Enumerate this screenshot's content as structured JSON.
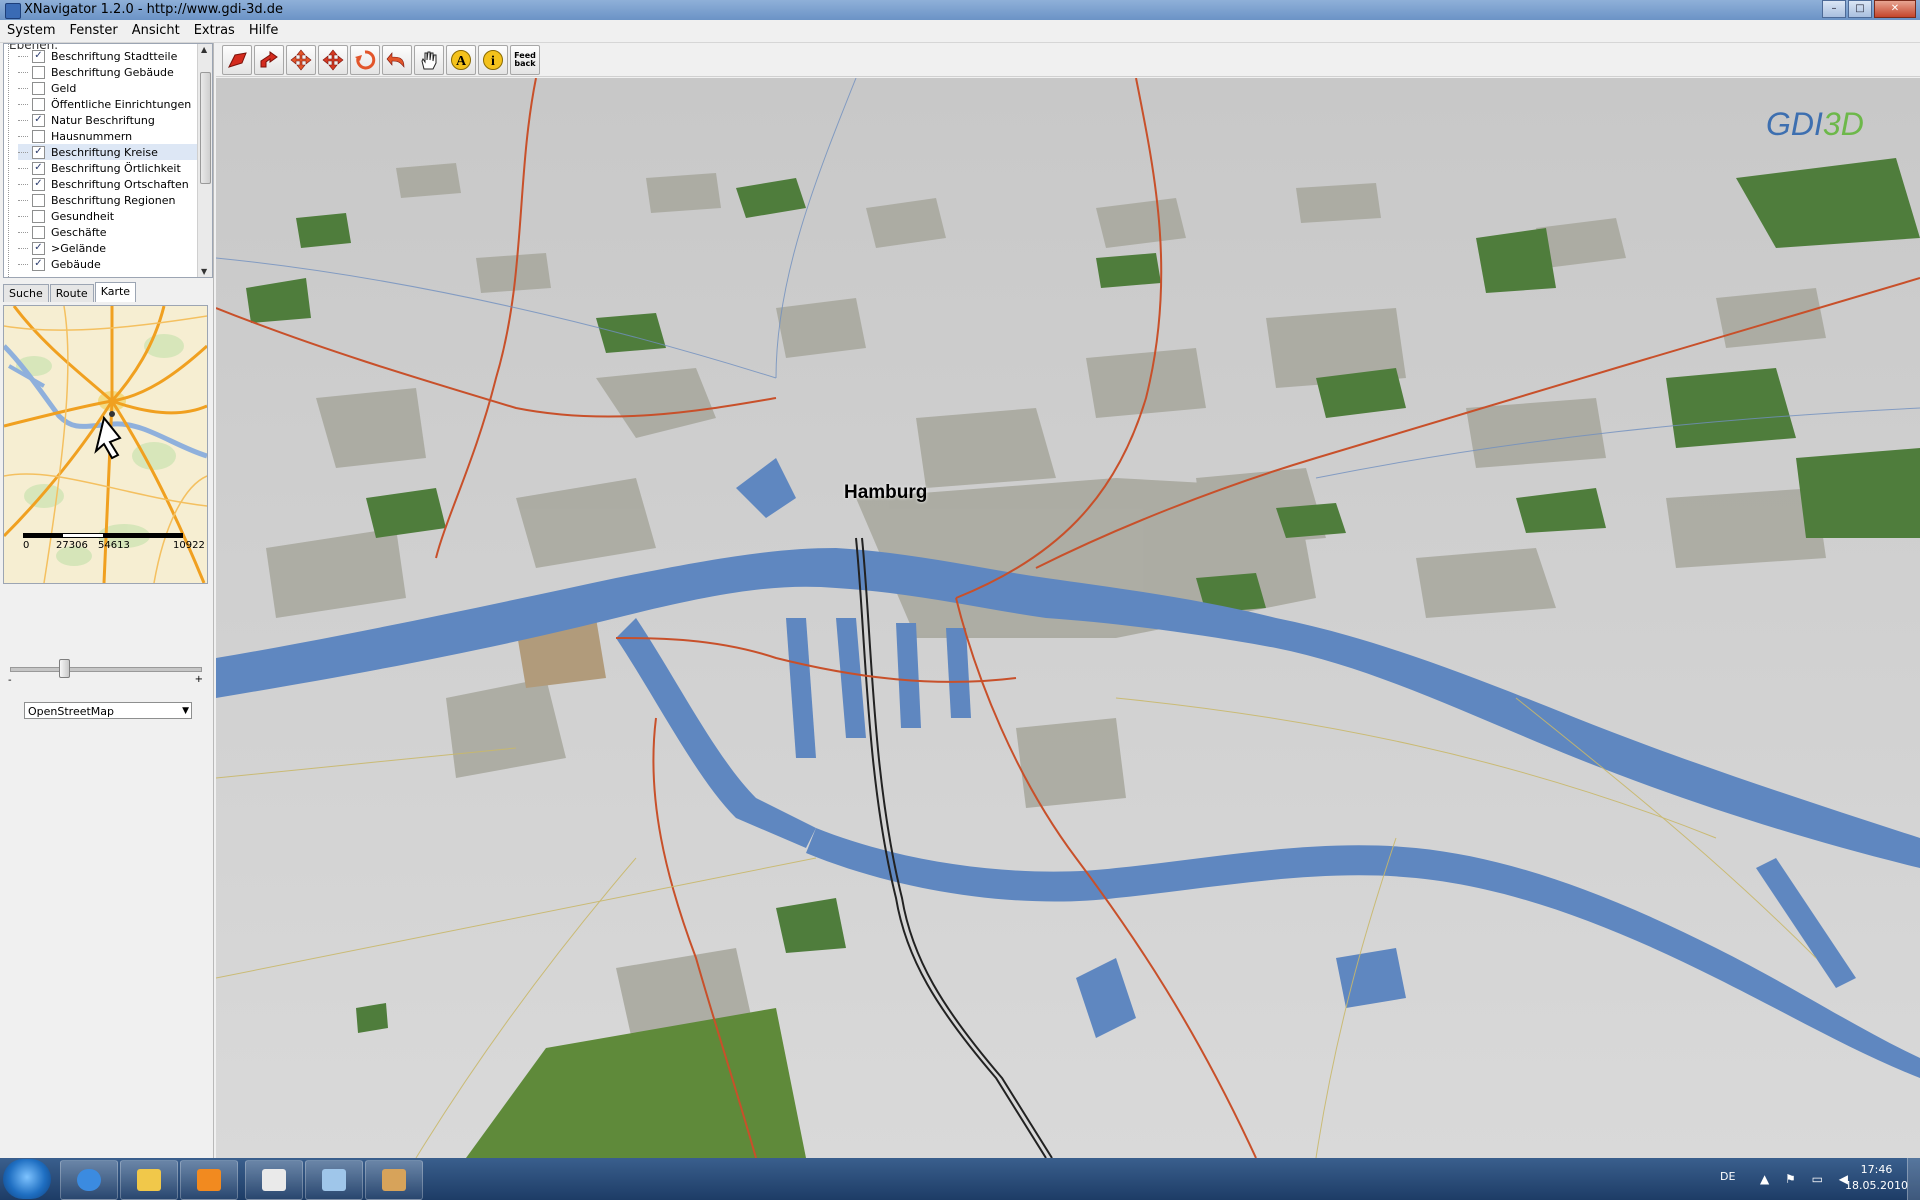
{
  "window": {
    "title": "XNavigator 1.2.0 - http://www.gdi-3d.de",
    "buttons": [
      "–",
      "□",
      "✕"
    ]
  },
  "menu": [
    "System",
    "Fenster",
    "Ansicht",
    "Extras",
    "Hilfe"
  ],
  "layers": {
    "header": "Ebenen:",
    "items": [
      {
        "label": "Beschriftung Stadtteile",
        "checked": true
      },
      {
        "label": "Beschriftung Gebäude",
        "checked": false
      },
      {
        "label": "Geld",
        "checked": false
      },
      {
        "label": "Öffentliche Einrichtungen",
        "checked": false
      },
      {
        "label": "Natur Beschriftung",
        "checked": true
      },
      {
        "label": "Hausnummern",
        "checked": false
      },
      {
        "label": "Beschriftung Kreise",
        "checked": true,
        "selected": true
      },
      {
        "label": "Beschriftung Örtlichkeit",
        "checked": true
      },
      {
        "label": "Beschriftung Ortschaften",
        "checked": true
      },
      {
        "label": "Beschriftung Regionen",
        "checked": false
      },
      {
        "label": "Gesundheit",
        "checked": false
      },
      {
        "label": "Geschäfte",
        "checked": false
      },
      {
        "label": ">Gelände",
        "checked": true
      },
      {
        "label": "Gebäude",
        "checked": true
      }
    ]
  },
  "tabs": [
    {
      "label": "Suche",
      "active": false
    },
    {
      "label": "Route",
      "active": false
    },
    {
      "label": "Karte",
      "active": true
    }
  ],
  "scale": {
    "labels": [
      "0",
      "27306",
      "54613",
      "10922"
    ]
  },
  "zoom": {
    "minus": "-",
    "plus": "+",
    "level": 0.27
  },
  "map_source": {
    "selected": "OpenStreetMap"
  },
  "toolbar": {
    "buttons": [
      "move-tool",
      "fly-tool",
      "pan-tool",
      "rotate-tool",
      "reset-view",
      "back-tool",
      "hand-tool",
      "annotation-tool",
      "info-tool",
      "feedback"
    ],
    "feedback_label": "Feed back"
  },
  "map": {
    "city_label": "Hamburg",
    "logo_prefix": "GDI",
    "logo_suffix": "3D",
    "colors": {
      "water": "#5f87c0",
      "forest": "#4f7d3c",
      "urban": "#a7a79d",
      "land": "#d2d2d2",
      "road": "#c8502a"
    }
  },
  "taskbar": {
    "language": "DE",
    "time": "17:46",
    "date": "18.05.2010",
    "tray_icons": [
      "flag-icon",
      "network-icon",
      "volume-icon"
    ]
  }
}
